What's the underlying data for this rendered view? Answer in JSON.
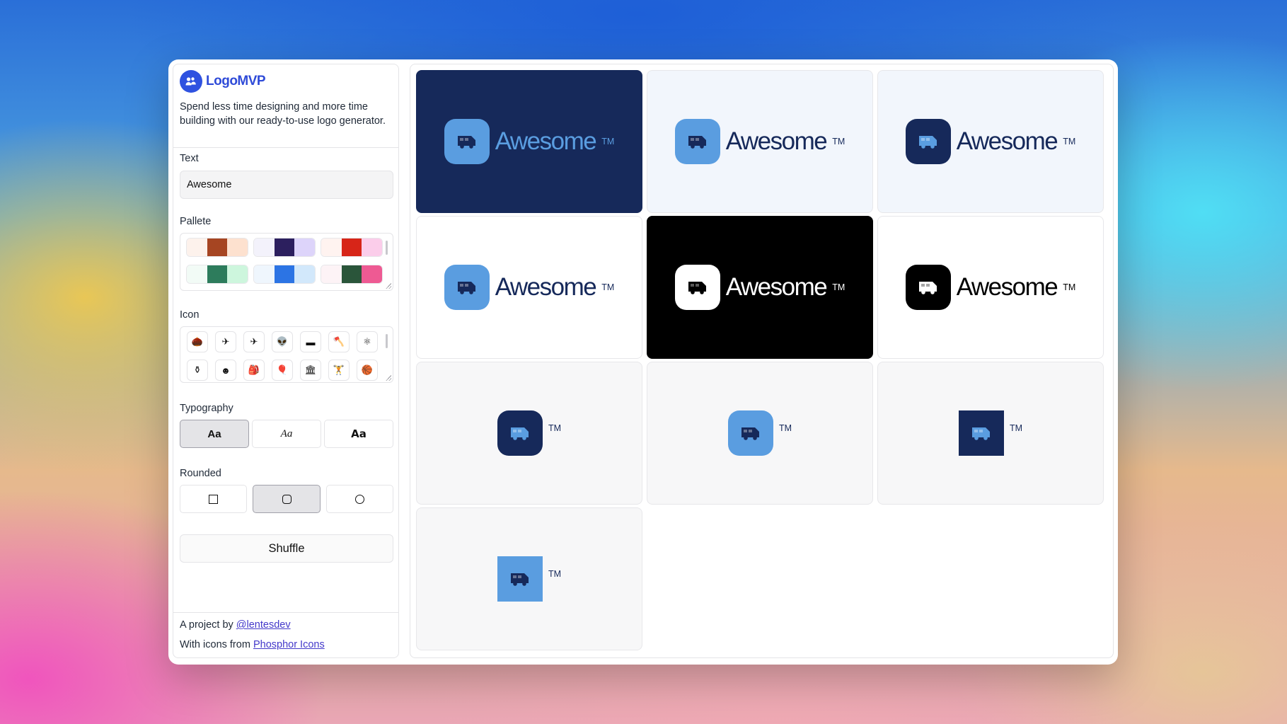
{
  "brand": {
    "name": "LogoMVP",
    "tagline": "Spend less time designing and more time building with our ready-to-use logo generator."
  },
  "text_field": {
    "label": "Text",
    "value": "Awesome"
  },
  "palette": {
    "label": "Pallete",
    "swatches": [
      [
        "#fdf2ec",
        "#a64522",
        "#fde1cf"
      ],
      [
        "#f3f2fb",
        "#2c1f5e",
        "#ddd4fa"
      ],
      [
        "#fff3f0",
        "#d72518",
        "#fbcdea"
      ],
      [
        "#f2fbf6",
        "#2d7c5c",
        "#cdf6dd"
      ],
      [
        "#eff6fd",
        "#2c74e4",
        "#d2e8fb"
      ],
      [
        "#fdf3f6",
        "#2a553a",
        "#ee5a93"
      ]
    ]
  },
  "icon_picker": {
    "label": "Icon",
    "icons": [
      "acorn-icon",
      "airplane-icon",
      "airplane-tilt-icon",
      "alien-icon",
      "archive-box-icon",
      "axe-icon",
      "atom-icon",
      "amphora-icon",
      "baby-icon",
      "backpack-icon",
      "balloon-icon",
      "bank-icon",
      "barbell-icon",
      "basketball-icon"
    ],
    "glyphs": [
      "🌰",
      "✈",
      "✈",
      "👽",
      "▬",
      "🪓",
      "⚛",
      "⚱",
      "☻",
      "🎒",
      "🎈",
      "🏛",
      "🏋",
      "🏀"
    ]
  },
  "typography": {
    "label": "Typography",
    "options": [
      "Aa",
      "Aa",
      "Aa"
    ],
    "selected": 0
  },
  "rounded": {
    "label": "Rounded",
    "options": [
      "square-icon",
      "rounded-square-icon",
      "circle-icon"
    ],
    "selected": 1
  },
  "shuffle_label": "Shuffle",
  "footer": {
    "project_prefix": "A project by",
    "project_link": "@lentesdev",
    "icons_prefix": "With icons from",
    "icons_link": "Phosphor Icons"
  },
  "colors": {
    "navy": "#16295a",
    "light_blue": "#5a9de0",
    "pale": "#f2f6fc",
    "black": "#000000",
    "white": "#ffffff",
    "gray_bg": "#f7f7f8"
  },
  "preview": {
    "wordmark": "Awesome",
    "tm": "TM",
    "mark_icon": "van-icon",
    "cards": [
      {
        "variant": "navy-bg-lightblue-mark",
        "text": "Awesome",
        "tm": "TM"
      },
      {
        "variant": "pale-bg-lightblue-mark",
        "text": "Awesome",
        "tm": "TM"
      },
      {
        "variant": "pale-bg-navy-mark",
        "text": "Awesome",
        "tm": "TM"
      },
      {
        "variant": "white-bg-lightblue-mark",
        "text": "Awesome",
        "tm": "TM"
      },
      {
        "variant": "black-bg-white-mark",
        "text": "Awesome",
        "tm": "TM"
      },
      {
        "variant": "white-bg-black-mark",
        "text": "Awesome",
        "tm": "TM"
      },
      {
        "variant": "icon-only-navy-rounded",
        "tm": "TM"
      },
      {
        "variant": "icon-only-lightblue-rounded",
        "tm": "TM"
      },
      {
        "variant": "icon-only-navy-square",
        "tm": "TM"
      },
      {
        "variant": "icon-only-lightblue-square",
        "tm": "TM"
      }
    ]
  }
}
